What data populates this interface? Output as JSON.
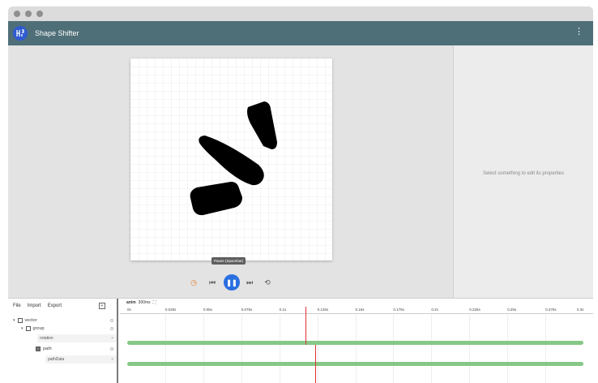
{
  "app": {
    "title": "Shape Shifter"
  },
  "icons": {
    "logo": "shape-shifter-logo-icon",
    "more": "more-vert-icon"
  },
  "colors": {
    "appbar": "#4f6f78",
    "accent": "#2a6fe0",
    "track": "#86c886",
    "playhead": "#d33333"
  },
  "properties_panel": {
    "empty_text": "Select something to edit its properties"
  },
  "player": {
    "tooltip": "Pause (Spacebar)"
  },
  "timeline": {
    "menu": [
      "File",
      "Import",
      "Export"
    ],
    "animation_name": "anim",
    "animation_duration": "300ms",
    "ruler_ticks": [
      "0s",
      "0.025s",
      "0.05s",
      "0.075s",
      "0.1s",
      "0.125s",
      "0.15s",
      "0.175s",
      "0.2s",
      "0.225s",
      "0.25s",
      "0.275s",
      "0.3s"
    ],
    "layers": {
      "vector": "vector",
      "group": "group",
      "rotation": "rotation",
      "path": "path",
      "pathData": "pathData"
    },
    "playhead_time_fraction": 0.39
  }
}
